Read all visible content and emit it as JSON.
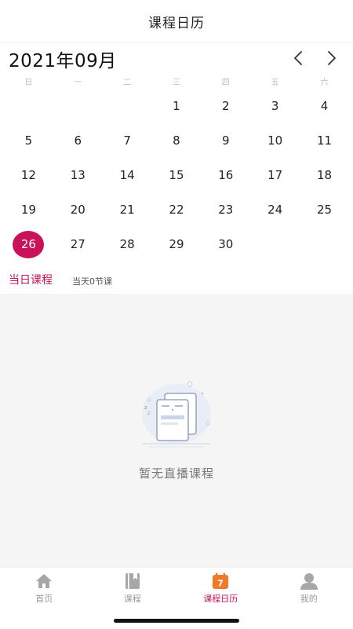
{
  "header": {
    "title": "课程日历"
  },
  "calendar": {
    "month_title": "2021年09月",
    "weekdays": [
      "日",
      "一",
      "二",
      "三",
      "四",
      "五",
      "六"
    ],
    "leading_blanks": 3,
    "days": [
      "1",
      "2",
      "3",
      "4",
      "5",
      "6",
      "7",
      "8",
      "9",
      "10",
      "11",
      "12",
      "13",
      "14",
      "15",
      "16",
      "17",
      "18",
      "19",
      "20",
      "21",
      "22",
      "23",
      "24",
      "25",
      "26",
      "27",
      "28",
      "29",
      "30"
    ],
    "selected_day": "26"
  },
  "today": {
    "label": "当日课程",
    "count_text": "当天0节课"
  },
  "empty_state": {
    "text": "暂无直播课程"
  },
  "tabbar": {
    "items": [
      {
        "label": "首页",
        "icon": "home-icon"
      },
      {
        "label": "课程",
        "icon": "book-icon"
      },
      {
        "label": "课程日历",
        "icon": "calendar-icon",
        "badge": "7",
        "active": true
      },
      {
        "label": "我的",
        "icon": "user-icon"
      }
    ]
  },
  "colors": {
    "accent": "#c9125a",
    "badge_orange": "#f07a2a",
    "inactive": "#999999",
    "content_bg": "#f5f5f5"
  }
}
